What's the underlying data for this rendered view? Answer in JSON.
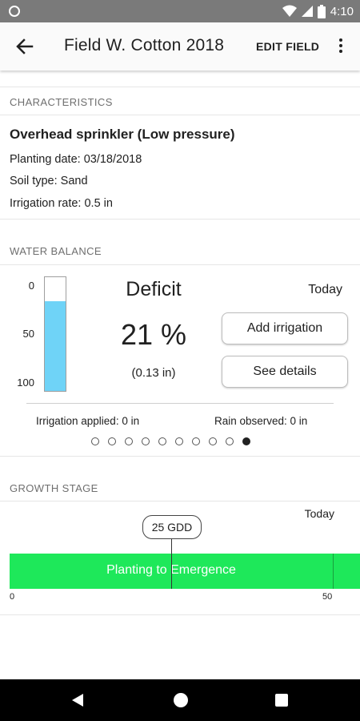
{
  "status_bar": {
    "time": "4:10"
  },
  "app_bar": {
    "title": "Field W. Cotton 2018",
    "edit_label": "EDIT FIELD"
  },
  "characteristics": {
    "header": "CHARACTERISTICS",
    "system": "Overhead sprinkler (Low pressure)",
    "planting_date": "Planting date: 03/18/2018",
    "soil_type": "Soil type: Sand",
    "irrigation_rate": "Irrigation rate: 0.5 in"
  },
  "water_balance": {
    "header": "WATER BALANCE",
    "gauge_labels": [
      "0",
      "50",
      "100"
    ],
    "gauge_level_percent": 79,
    "status": "Deficit",
    "percent": "21 %",
    "inches": "(0.13 in)",
    "day": "Today",
    "add_irrigation": "Add irrigation",
    "see_details": "See details",
    "irrigation_applied": "Irrigation applied: 0 in",
    "rain_observed": "Rain observed: 0 in",
    "page_count": 10,
    "active_page": 10
  },
  "growth_stage": {
    "header": "GROWTH STAGE",
    "day": "Today",
    "gdd_marker": "25 GDD",
    "stage_label": "Planting to Emergence",
    "axis_start": "0",
    "axis_end": "50",
    "colors": {
      "stage": "#1ee85a"
    }
  },
  "colors": {
    "gauge_fill": "#6fd3f7"
  }
}
